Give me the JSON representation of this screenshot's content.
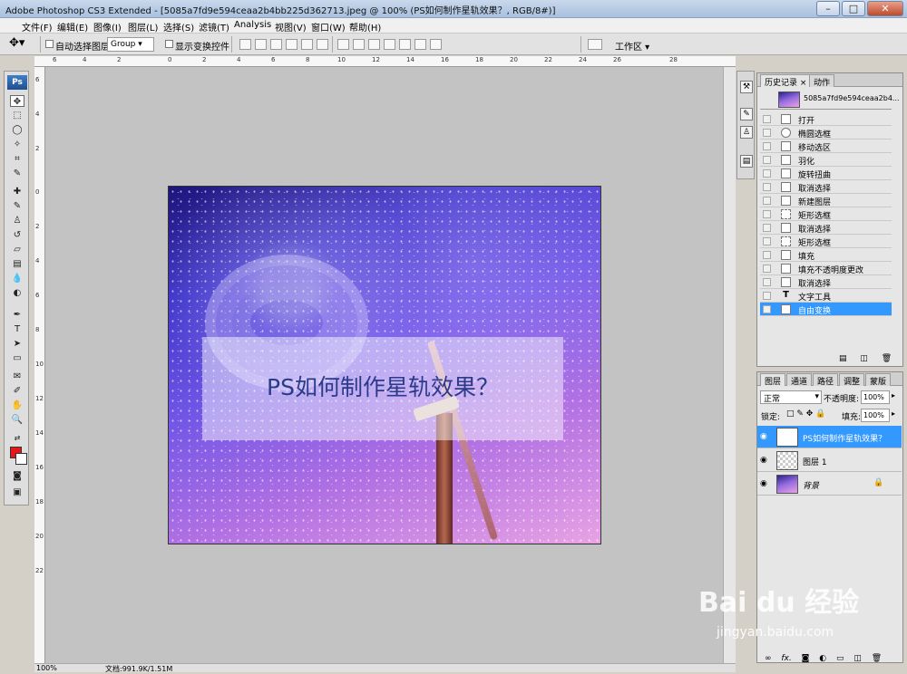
{
  "window": {
    "title": "Adobe Photoshop CS3 Extended - [5085a7fd9e594ceaa2b4bb225d362713.jpeg @ 100% (PS如何制作星轨效果？, RGB/8#)]",
    "minimize": "–",
    "maximize": "□",
    "close": "✕"
  },
  "menu": [
    "文件(F)",
    "编辑(E)",
    "图像(I)",
    "图层(L)",
    "选择(S)",
    "滤镜(T)",
    "Analysis",
    "视图(V)",
    "窗口(W)",
    "帮助(H)"
  ],
  "options": {
    "auto_select_label": "自动选择图层",
    "group_value": "Group",
    "show_transform_label": "显示变换控件",
    "workspace_label": "工作区 ▾"
  },
  "ruler": {
    "h_ticks": [
      "6",
      "4",
      "2",
      "0",
      "2",
      "4",
      "6",
      "8",
      "10",
      "12",
      "14",
      "16",
      "18",
      "20",
      "22",
      "24",
      "26",
      "28"
    ],
    "v_ticks": [
      "6",
      "4",
      "2",
      "0",
      "2",
      "4",
      "6",
      "8",
      "10",
      "12",
      "14",
      "16",
      "18",
      "20",
      "22"
    ]
  },
  "document": {
    "overlay_text": "PS如何制作星轨效果？"
  },
  "status": {
    "zoom": "100%",
    "doc_info": "文档:991.9K/1.51M"
  },
  "history_panel": {
    "tabs": [
      "历史记录 ×",
      "动作"
    ],
    "snapshot_name": "5085a7fd9e594ceaa2b4...",
    "items": [
      "打开",
      "椭圆选框",
      "移动选区",
      "羽化",
      "旋转扭曲",
      "取消选择",
      "新建图层",
      "矩形选框",
      "取消选择",
      "矩形选框",
      "填充",
      "填充不透明度更改",
      "取消选择",
      "文字工具",
      "自由变换"
    ]
  },
  "layers_panel": {
    "tabs": [
      "图层",
      "通道",
      "路径",
      "调整",
      "蒙版"
    ],
    "blend_mode": "正常",
    "opacity_label": "不透明度:",
    "opacity_value": "100%",
    "lock_label": "锁定:",
    "fill_label": "填充:",
    "fill_value": "100%",
    "layers": [
      "PS如何制作星轨效果？",
      "图层 1",
      "背景"
    ]
  },
  "watermark": {
    "brand": "Bai du 经验",
    "url": "jingyan.baidu.com"
  }
}
